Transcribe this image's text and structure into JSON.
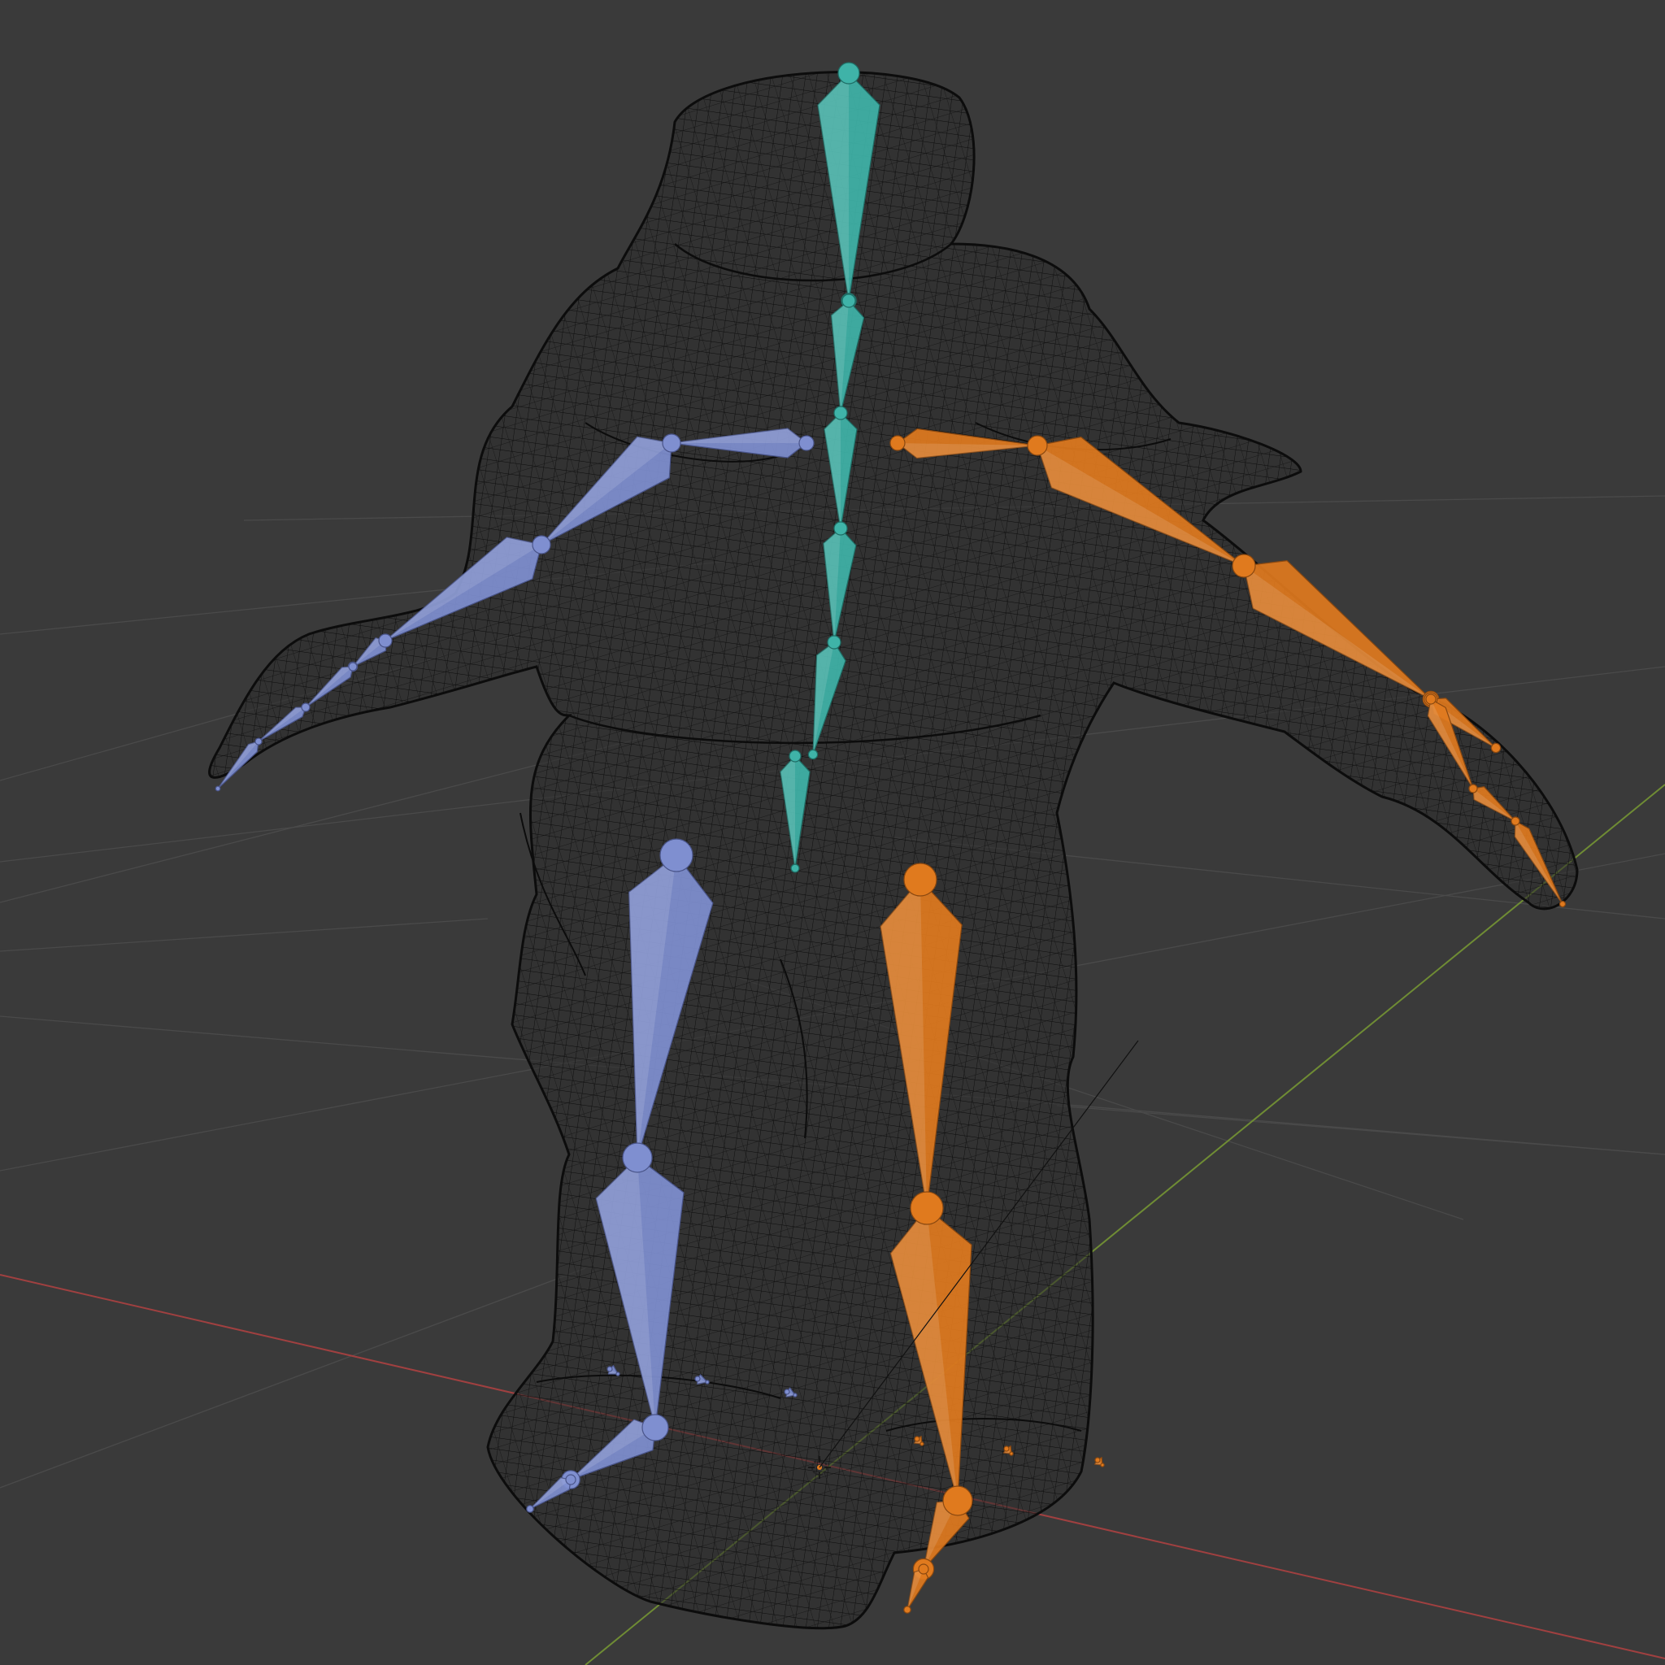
{
  "viewport": {
    "mode": "wireframe",
    "background": "#3a3a3a",
    "grid_color": "#4a4a4a",
    "x_axis_color": "#b04848",
    "y_axis_color": "#7a9a3a"
  },
  "mesh": {
    "name": "character-wireframe",
    "wire_color": "#000000"
  },
  "armature": {
    "groups": [
      {
        "name": "spine",
        "color": "#3fb3a8",
        "edge": "#1f6e66"
      },
      {
        "name": "left-side",
        "color": "#7f8fd0",
        "edge": "#4a558a"
      },
      {
        "name": "right-side",
        "color": "#e07a1e",
        "edge": "#8a4810"
      }
    ]
  },
  "icons": {
    "origin": "3d-cursor-icon"
  }
}
